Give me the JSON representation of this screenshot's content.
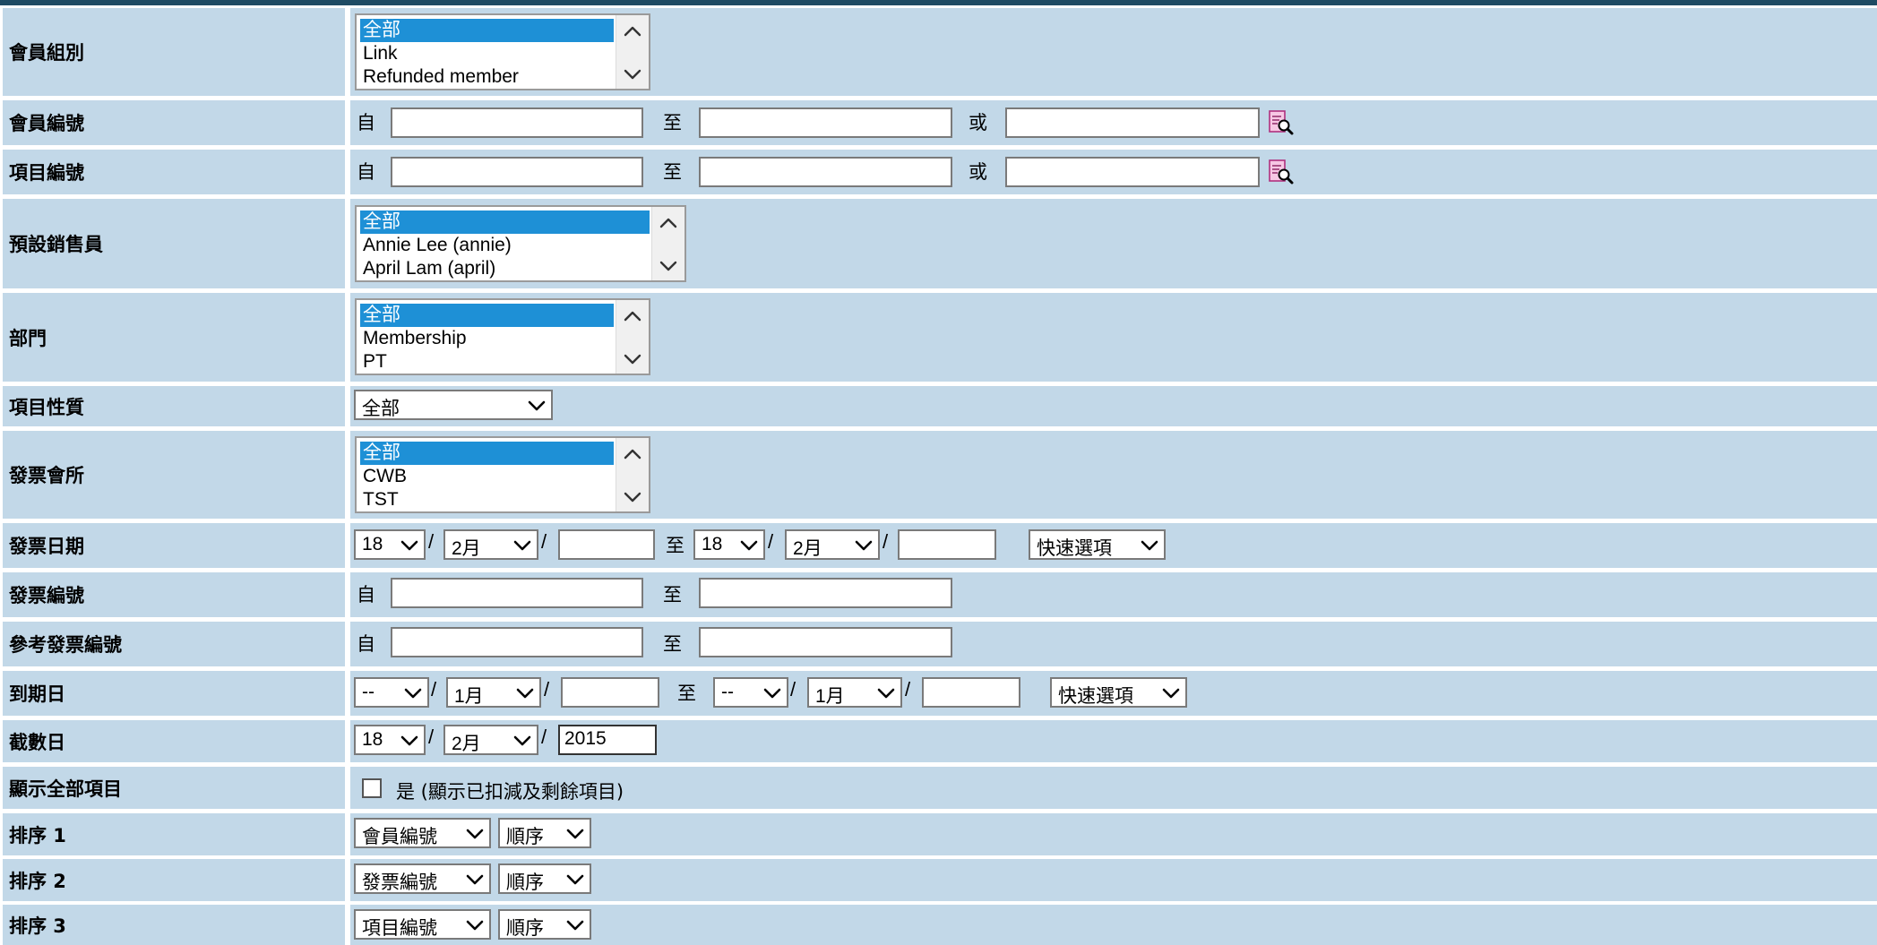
{
  "rows": {
    "member_group": {
      "label": "會員組別",
      "options": [
        "全部",
        "Link",
        "Refunded member"
      ]
    },
    "member_no": {
      "label": "會員編號",
      "from": "自",
      "to": "至",
      "or": "或",
      "search_icon": "search-document-icon"
    },
    "item_no": {
      "label": "項目編號",
      "from": "自",
      "to": "至",
      "or": "或",
      "search_icon": "search-document-icon"
    },
    "default_salesperson": {
      "label": "預設銷售員",
      "options": [
        "全部",
        "Annie Lee (annie)",
        "April Lam (april)"
      ]
    },
    "department": {
      "label": "部門",
      "options": [
        "全部",
        "Membership",
        "PT"
      ]
    },
    "item_nature": {
      "label": "項目性質",
      "value": "全部"
    },
    "invoice_club": {
      "label": "發票會所",
      "options": [
        "全部",
        "CWB",
        "TST"
      ]
    },
    "invoice_date": {
      "label": "發票日期",
      "from_day": "18",
      "from_month": "2月",
      "from_year": "",
      "to": "至",
      "to_day": "18",
      "to_month": "2月",
      "to_year": "",
      "quick": "快速選項"
    },
    "invoice_no": {
      "label": "發票編號",
      "from": "自",
      "to": "至"
    },
    "ref_invoice_no": {
      "label": "參考發票編號",
      "from": "自",
      "to": "至"
    },
    "expiry_date": {
      "label": "到期日",
      "from_day": "--",
      "from_month": "1月",
      "from_year": "",
      "to": "至",
      "to_day": "--",
      "to_month": "1月",
      "to_year": "",
      "quick": "快速選項"
    },
    "cutoff_date": {
      "label": "截數日",
      "day": "18",
      "month": "2月",
      "year": "2015"
    },
    "show_all_items": {
      "label": "顯示全部項目",
      "checkbox_text": "是 (顯示已扣減及剩餘項目)",
      "checked": false
    },
    "sort1": {
      "label": "排序 1",
      "field": "會員編號",
      "order": "順序"
    },
    "sort2": {
      "label": "排序 2",
      "field": "發票編號",
      "order": "順序"
    },
    "sort3": {
      "label": "排序 3",
      "field": "項目編號",
      "order": "順序"
    }
  },
  "colors": {
    "row_bg": "#c2d8e8",
    "highlight": "#1e90d6",
    "top_bar": "#1f4b63"
  }
}
